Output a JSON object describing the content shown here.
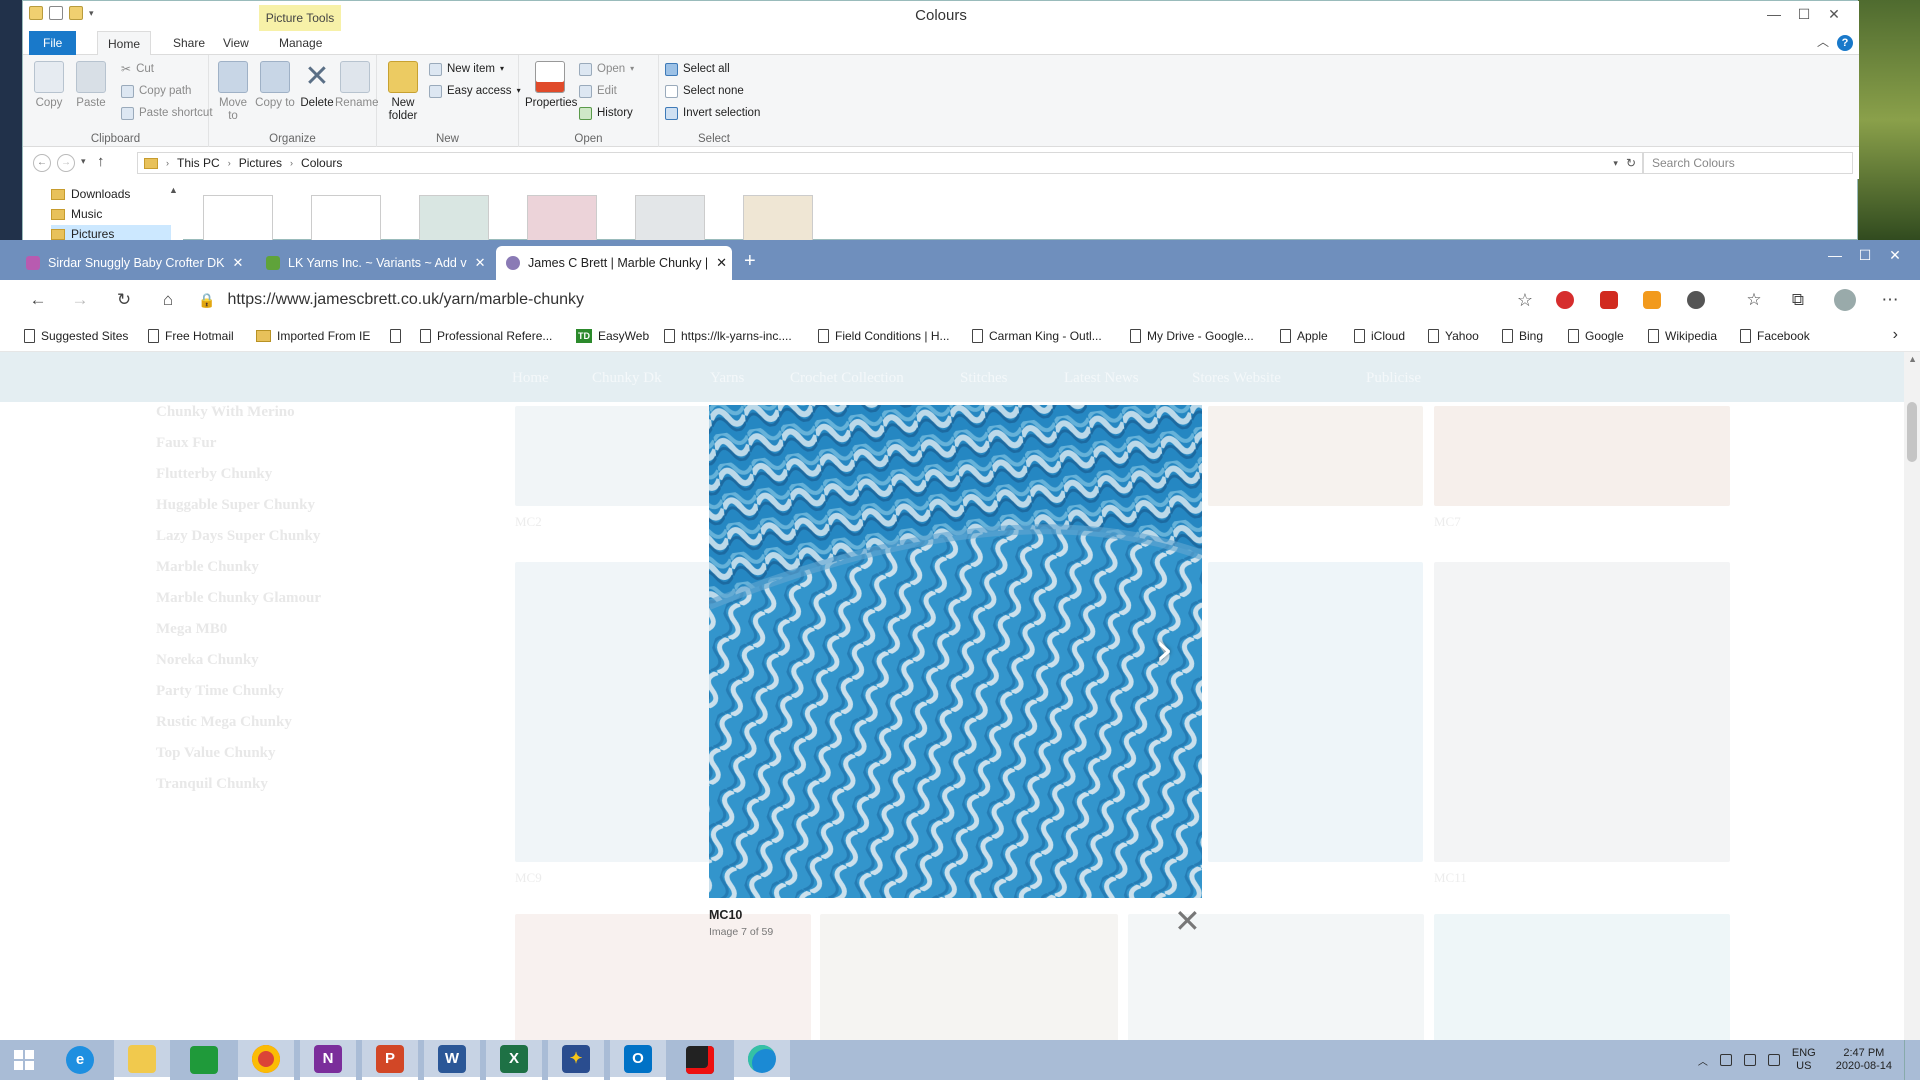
{
  "explorer": {
    "title": "Colours",
    "picture_tools": "Picture Tools",
    "tabs": {
      "file": "File",
      "home": "Home",
      "share": "Share",
      "view": "View",
      "manage": "Manage"
    },
    "clipboard": {
      "copy": "Copy",
      "paste": "Paste",
      "cut": "Cut",
      "copy_path": "Copy path",
      "paste_shortcut": "Paste shortcut",
      "label": "Clipboard"
    },
    "organize": {
      "move_to": "Move to",
      "copy_to": "Copy to",
      "delete": "Delete",
      "rename": "Rename",
      "label": "Organize"
    },
    "new": {
      "new_folder": "New folder",
      "new_item": "New item",
      "easy_access": "Easy access",
      "label": "New"
    },
    "open": {
      "properties": "Properties",
      "open": "Open",
      "edit": "Edit",
      "history": "History",
      "label": "Open"
    },
    "select": {
      "select_all": "Select all",
      "select_none": "Select none",
      "invert": "Invert selection",
      "label": "Select"
    },
    "breadcrumb": [
      "This PC",
      "Pictures",
      "Colours"
    ],
    "search_placeholder": "Search Colours",
    "tree": [
      "Downloads",
      "Music",
      "Pictures"
    ]
  },
  "browser": {
    "tabs": [
      {
        "title": "Sirdar Snuggly Baby Crofter DK",
        "favicon_color": "#b85bb0"
      },
      {
        "title": "LK Yarns Inc. ~ Variants ~ Add v",
        "favicon_color": "#5fa33a"
      },
      {
        "title": "James C Brett | Marble Chunky |",
        "favicon_color": "#8a7ab5"
      }
    ],
    "url": "https://www.jamescbrett.co.uk/yarn/marble-chunky",
    "bookmarks": [
      {
        "label": "Suggested Sites",
        "type": "page"
      },
      {
        "label": "Free Hotmail",
        "type": "page"
      },
      {
        "label": "Imported From IE",
        "type": "folder"
      },
      {
        "label": "",
        "type": "page"
      },
      {
        "label": "Professional Refere...",
        "type": "page"
      },
      {
        "label": "EasyWeb",
        "type": "td"
      },
      {
        "label": "https://lk-yarns-inc....",
        "type": "page"
      },
      {
        "label": "Field Conditions | H...",
        "type": "page"
      },
      {
        "label": "Carman King - Outl...",
        "type": "page"
      },
      {
        "label": "My Drive - Google...",
        "type": "page"
      },
      {
        "label": "Apple",
        "type": "page"
      },
      {
        "label": "iCloud",
        "type": "page"
      },
      {
        "label": "Yahoo",
        "type": "page"
      },
      {
        "label": "Bing",
        "type": "page"
      },
      {
        "label": "Google",
        "type": "page"
      },
      {
        "label": "Wikipedia",
        "type": "page"
      },
      {
        "label": "Facebook",
        "type": "page"
      }
    ]
  },
  "site": {
    "nav": [
      "Home",
      "Chunky Dk",
      "Yarns",
      "Crochet Collection",
      "Stitches",
      "Latest News",
      "Stores Website",
      "Publicise"
    ],
    "sidebar": [
      "Chunky With Merino",
      "Faux Fur",
      "Flutterby Chunky",
      "Huggable Super Chunky",
      "Lazy Days Super Chunky",
      "Marble Chunky",
      "Marble Chunky Glamour",
      "Mega MB0",
      "Noreka Chunky",
      "Party Time Chunky",
      "Rustic Mega Chunky",
      "Top Value Chunky",
      "Tranquil Chunky"
    ],
    "swatch_labels": [
      "MC2",
      "MC7",
      "MC9",
      "MC11"
    ]
  },
  "lightbox": {
    "title": "MC10",
    "counter": "Image 7 of 59"
  },
  "tray": {
    "lang": "ENG",
    "region": "US",
    "time": "2:47 PM",
    "date": "2020-08-14"
  },
  "taskbar_apps": [
    "start",
    "internet-explorer",
    "file-explorer",
    "store",
    "chrome",
    "onenote",
    "powerpoint",
    "word",
    "excel",
    "app",
    "outlook",
    "recorder",
    "edge"
  ]
}
